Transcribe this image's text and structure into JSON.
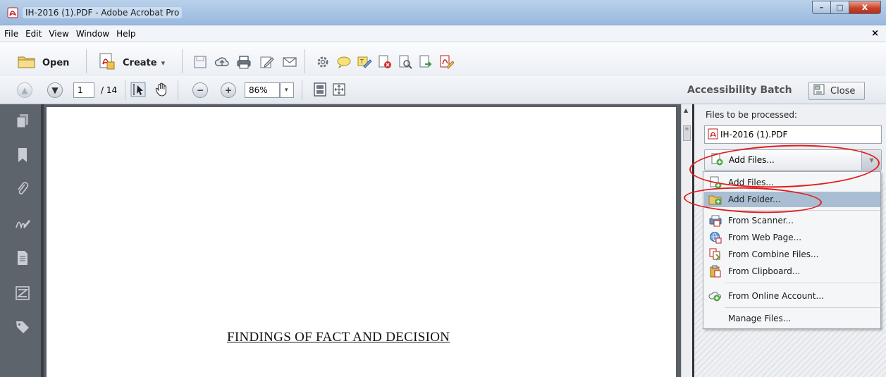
{
  "window": {
    "title": "IH-2016 (1).PDF - Adobe Acrobat Pro",
    "min_label": "–",
    "max_label": "□",
    "close_label": "x"
  },
  "menubar": {
    "items": [
      "File",
      "Edit",
      "View",
      "Window",
      "Help"
    ],
    "doc_close": "×"
  },
  "toolbar": {
    "open_label": "Open",
    "create_label": "Create",
    "create_caret": "▾",
    "icons": [
      "save-icon",
      "cloud-upload-icon",
      "print-icon",
      "edit-icon",
      "email-icon",
      "gear-icon",
      "comment-icon",
      "highlight-icon",
      "pdf-delete-icon",
      "pdf-search-icon",
      "pdf-export-icon",
      "pdf-sign-icon"
    ]
  },
  "navbar": {
    "prev_page": "▲",
    "next_page": "▼",
    "page_current": "1",
    "page_total": "/ 14",
    "zoom_out": "−",
    "zoom_in": "+",
    "zoom_value": "86%",
    "zoom_caret": "▾",
    "panel_title": "Accessibility Batch",
    "close_label": "Close"
  },
  "document": {
    "heading": "FINDINGS OF FACT AND DECISION"
  },
  "panel": {
    "files_label": "Files to be processed:",
    "file_name": "IH-2016 (1).PDF",
    "add_files_combo": "Add Files..."
  },
  "dropdown": {
    "items": [
      {
        "label": "Add Files...",
        "icon": "add-files-icon",
        "highlighted": false
      },
      {
        "label": "Add Folder...",
        "icon": "add-folder-icon",
        "highlighted": true
      },
      {
        "label": "From Scanner...",
        "icon": "scanner-icon",
        "highlighted": false
      },
      {
        "label": "From Web Page...",
        "icon": "web-page-icon",
        "highlighted": false
      },
      {
        "label": "From Combine Files...",
        "icon": "combine-files-icon",
        "highlighted": false
      },
      {
        "label": "From Clipboard...",
        "icon": "clipboard-icon",
        "highlighted": false
      },
      {
        "label": "From Online Account...",
        "icon": "online-account-icon",
        "highlighted": false
      },
      {
        "label": "Manage Files...",
        "icon": "",
        "highlighted": false
      }
    ]
  },
  "colors": {
    "annotation": "#e41b1b",
    "highlight": "#a9bed3",
    "nav_background": "#5d646c"
  }
}
